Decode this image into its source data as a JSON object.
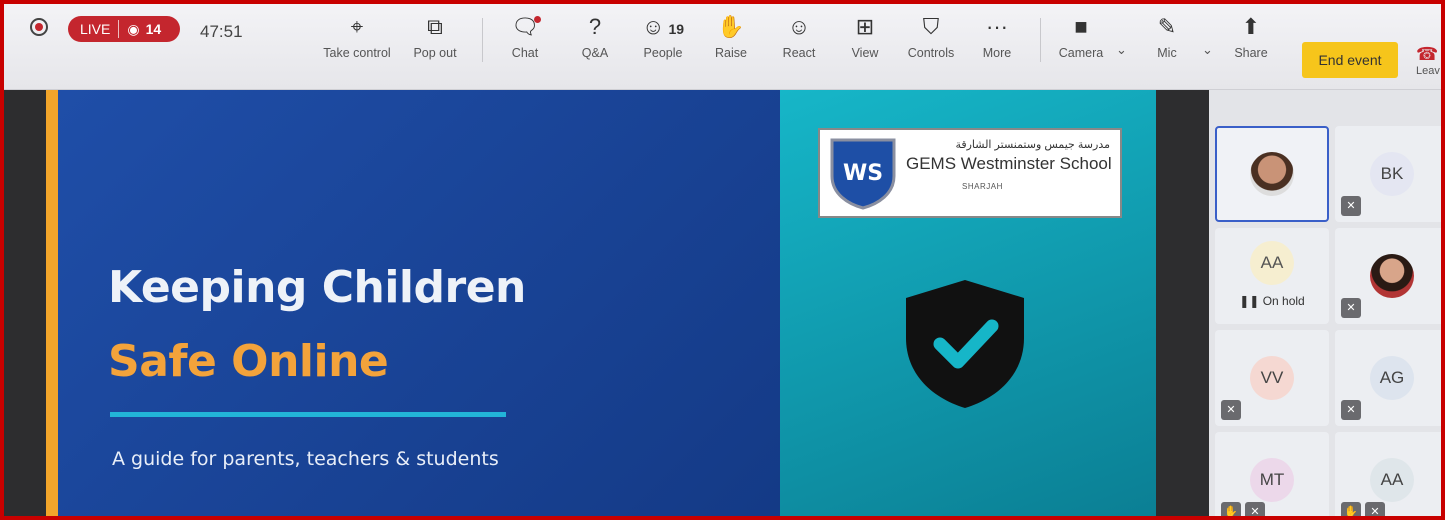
{
  "toolbar": {
    "live_label": "LIVE",
    "viewer_count": "14",
    "timer": "47:51",
    "buttons": [
      {
        "label": "Take control",
        "icon": "take-control-icon"
      },
      {
        "label": "Pop out",
        "icon": "pop-out-icon"
      },
      {
        "label": "Chat",
        "icon": "chat-icon"
      },
      {
        "label": "Q&A",
        "icon": "qa-icon"
      },
      {
        "label": "People",
        "icon": "people-icon",
        "count": "19"
      },
      {
        "label": "Raise",
        "icon": "hand-icon"
      },
      {
        "label": "React",
        "icon": "smile-icon"
      },
      {
        "label": "View",
        "icon": "grid-icon"
      },
      {
        "label": "Controls",
        "icon": "shield-settings-icon"
      },
      {
        "label": "More",
        "icon": "more-icon"
      },
      {
        "label": "Camera",
        "icon": "camera-off-icon"
      },
      {
        "label": "Mic",
        "icon": "mic-off-icon"
      },
      {
        "label": "Share",
        "icon": "share-icon"
      }
    ],
    "end_event": "End event",
    "leave": "Leav"
  },
  "slide": {
    "title_line1": "Keeping Children",
    "title_line2": "Safe Online",
    "subtitle": "A guide for parents, teachers & students",
    "logo_mark": "WS",
    "logo_arabic": "مدرسة جيمس وستمنستر الشارقة",
    "logo_name": "GEMS Westminster School",
    "logo_sub": "SHARJAH",
    "colors": {
      "accent_orange": "#f3a33b",
      "slide_blue": "#1f4ea8",
      "slide_teal": "#16b6c8",
      "rule": "#22b5d8"
    }
  },
  "participants": [
    {
      "initials": "",
      "type": "photo",
      "selected": true
    },
    {
      "initials": "BK",
      "muted": true
    },
    {
      "initials": "AA",
      "status": "On hold"
    },
    {
      "initials": "",
      "type": "photo2",
      "muted": true
    },
    {
      "initials": "VV",
      "muted": true
    },
    {
      "initials": "AG",
      "muted": true
    },
    {
      "initials": "MT",
      "muted": true,
      "hand": true
    },
    {
      "initials": "AA",
      "muted": true,
      "hand": true
    }
  ],
  "colors": {
    "live_red": "#c4262e",
    "end_event": "#f6c51b",
    "frame_red": "#c80000"
  }
}
